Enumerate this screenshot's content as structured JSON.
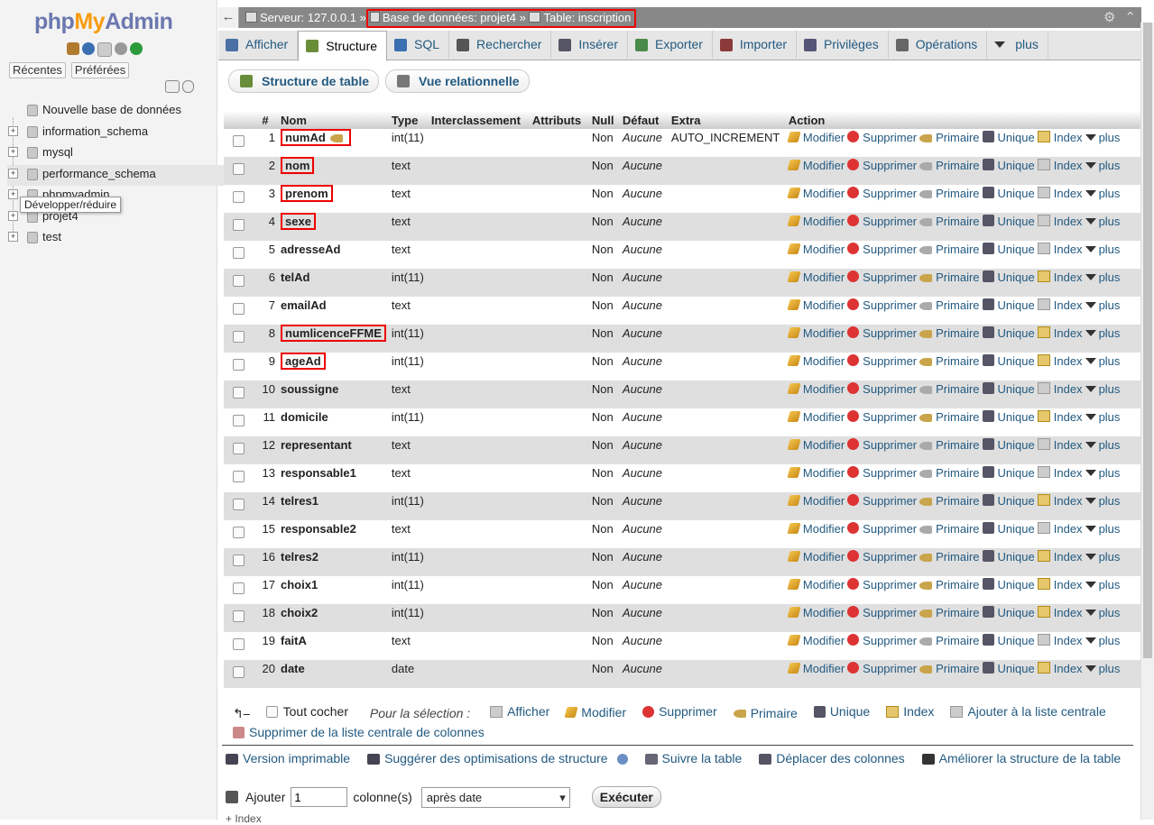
{
  "nav": {
    "logo_php": "php",
    "logo_my": "My",
    "logo_admin": "Admin",
    "tab_recent": "Récentes",
    "tab_favorites": "Préférées",
    "tree": [
      {
        "label": "Nouvelle base de données",
        "kind": "new"
      },
      {
        "label": "information_schema",
        "kind": "db"
      },
      {
        "label": "mysql",
        "kind": "db"
      },
      {
        "label": "performance_schema",
        "kind": "db",
        "active": true
      },
      {
        "label": "phpmyadmin",
        "kind": "db"
      },
      {
        "label": "projet4",
        "kind": "db"
      },
      {
        "label": "test",
        "kind": "db"
      }
    ],
    "tooltip": "Développer/réduire"
  },
  "breadcrumb": {
    "server": "Serveur: 127.0.0.1",
    "sep": "»",
    "database": "Base de données: projet4",
    "table": "Table: inscription"
  },
  "tabs": [
    "Afficher",
    "Structure",
    "SQL",
    "Rechercher",
    "Insérer",
    "Exporter",
    "Importer",
    "Privilèges",
    "Opérations",
    "plus"
  ],
  "active_tab": "Structure",
  "subtabs": [
    "Structure de table",
    "Vue relationnelle"
  ],
  "table": {
    "headers": [
      "#",
      "Nom",
      "Type",
      "Interclassement",
      "Attributs",
      "Null",
      "Défaut",
      "Extra",
      "Action"
    ],
    "actions": [
      "Modifier",
      "Supprimer",
      "Primaire",
      "Unique",
      "Index",
      "plus"
    ],
    "rows": [
      {
        "n": "1",
        "name": "numAd",
        "type": "int(11)",
        "null": "Non",
        "default": "Aucune",
        "extra": "AUTO_INCREMENT",
        "hl": true,
        "key": true
      },
      {
        "n": "2",
        "name": "nom",
        "type": "text",
        "null": "Non",
        "default": "Aucune",
        "extra": "",
        "hl": true
      },
      {
        "n": "3",
        "name": "prenom",
        "type": "text",
        "null": "Non",
        "default": "Aucune",
        "extra": "",
        "hl": true
      },
      {
        "n": "4",
        "name": "sexe",
        "type": "text",
        "null": "Non",
        "default": "Aucune",
        "extra": "",
        "hl": true
      },
      {
        "n": "5",
        "name": "adresseAd",
        "type": "text",
        "null": "Non",
        "default": "Aucune",
        "extra": ""
      },
      {
        "n": "6",
        "name": "telAd",
        "type": "int(11)",
        "null": "Non",
        "default": "Aucune",
        "extra": ""
      },
      {
        "n": "7",
        "name": "emailAd",
        "type": "text",
        "null": "Non",
        "default": "Aucune",
        "extra": ""
      },
      {
        "n": "8",
        "name": "numlicenceFFME",
        "type": "int(11)",
        "null": "Non",
        "default": "Aucune",
        "extra": "",
        "hl": true
      },
      {
        "n": "9",
        "name": "ageAd",
        "type": "int(11)",
        "null": "Non",
        "default": "Aucune",
        "extra": "",
        "hl": true
      },
      {
        "n": "10",
        "name": "soussigne",
        "type": "text",
        "null": "Non",
        "default": "Aucune",
        "extra": ""
      },
      {
        "n": "11",
        "name": "domicile",
        "type": "int(11)",
        "null": "Non",
        "default": "Aucune",
        "extra": ""
      },
      {
        "n": "12",
        "name": "representant",
        "type": "text",
        "null": "Non",
        "default": "Aucune",
        "extra": ""
      },
      {
        "n": "13",
        "name": "responsable1",
        "type": "text",
        "null": "Non",
        "default": "Aucune",
        "extra": ""
      },
      {
        "n": "14",
        "name": "telres1",
        "type": "int(11)",
        "null": "Non",
        "default": "Aucune",
        "extra": ""
      },
      {
        "n": "15",
        "name": "responsable2",
        "type": "text",
        "null": "Non",
        "default": "Aucune",
        "extra": ""
      },
      {
        "n": "16",
        "name": "telres2",
        "type": "int(11)",
        "null": "Non",
        "default": "Aucune",
        "extra": ""
      },
      {
        "n": "17",
        "name": "choix1",
        "type": "int(11)",
        "null": "Non",
        "default": "Aucune",
        "extra": ""
      },
      {
        "n": "18",
        "name": "choix2",
        "type": "int(11)",
        "null": "Non",
        "default": "Aucune",
        "extra": ""
      },
      {
        "n": "19",
        "name": "faitA",
        "type": "text",
        "null": "Non",
        "default": "Aucune",
        "extra": ""
      },
      {
        "n": "20",
        "name": "date",
        "type": "date",
        "null": "Non",
        "default": "Aucune",
        "extra": ""
      }
    ]
  },
  "selection": {
    "check_all": "Tout cocher",
    "for_selection": "Pour la sélection :",
    "items": [
      "Afficher",
      "Modifier",
      "Supprimer",
      "Primaire",
      "Unique",
      "Index",
      "Ajouter à la liste centrale"
    ],
    "remove_central": "Supprimer de la liste centrale de colonnes"
  },
  "links": [
    "Version imprimable",
    "Suggérer des optimisations de structure",
    "Suivre la table",
    "Déplacer des colonnes",
    "Améliorer la structure de la table"
  ],
  "add": {
    "label": "Ajouter",
    "count": "1",
    "columns_label": "colonne(s)",
    "position": "après date",
    "submit": "Exécuter"
  },
  "index_hint": "+ Index",
  "colors": {
    "link": "#235a81",
    "highlight": "#ee0000",
    "topbar": "#888888"
  }
}
